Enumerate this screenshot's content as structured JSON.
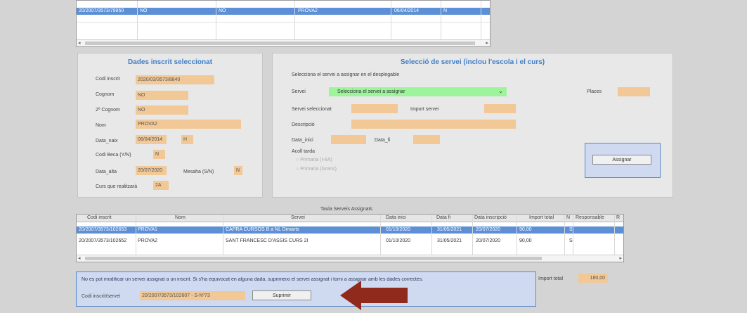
{
  "top_table": {
    "row": [
      "20/2007/3573/79950",
      "NO",
      "NO",
      "PROVA2",
      "06/04/2014",
      "N"
    ]
  },
  "panel_left": {
    "title": "Dades inscrit seleccionat",
    "fields": [
      {
        "label": "Codi inscrit",
        "value": "2020/03/3573/8840"
      },
      {
        "label": "Cognom",
        "value": "NO"
      },
      {
        "label": "2º Cognom",
        "value": "NO"
      },
      {
        "label": "Nom",
        "value": "PROVA2"
      },
      {
        "label": "Data_naix",
        "value": "06/04/2014",
        "extra": "H"
      },
      {
        "label": "Codi Beca (Y/N)",
        "value": "N"
      },
      {
        "label": "Data_alta",
        "value": "20/07/2020",
        "extra_label": "Mesaha (S/N)",
        "extra": "N"
      },
      {
        "label": "Curs que realitzarà",
        "value": "2A"
      }
    ]
  },
  "panel_right": {
    "title": "Selecció de servei (inclou l'escola i el curs)",
    "instruction": "Selecciona el servei a assignar en el desplegable",
    "servei_label": "Servei",
    "servei_select": "Selecciona el servei a assignar",
    "places_label": "Places",
    "servei_seleccionat_label": "Servei seleccionat",
    "import_servei_label": "Import servei",
    "descripcio_label": "Descripció",
    "data_inici_label": "Data_inici",
    "data_fi_label": "Data_fi",
    "acollida_label": "Acoll tarda",
    "radio1": "Primaria (I-6A)",
    "radio2": "Primaria (Grans)",
    "assign_button": "Assignar"
  },
  "assigned_table": {
    "caption": "Taula Serveis Assignats",
    "columns": [
      "Codi inscrit",
      "Nom",
      "Servei",
      "Data inici",
      "Data fi",
      "Data inscripció",
      "Import total",
      "N",
      "Responsable",
      "R"
    ],
    "rows": [
      [
        "20/2007/3573/102653",
        "PROVA1",
        "CAPRA CURSOS B a NL Dimarts",
        "01/10/2020",
        "31/05/2021",
        "20/07/2020",
        "90,00",
        "S",
        "",
        ""
      ],
      [
        "20/2007/3573/102652",
        "PROVA2",
        "SANT FRANCESC D'ASSIS CURS 2I",
        "01/10/2020",
        "31/05/2021",
        "20/07/2020",
        "90,00",
        "S",
        "",
        ""
      ]
    ]
  },
  "bottom_panel": {
    "message": "No es pot modificar un servei assignat a un inscrit. Si s'ha equivocat en alguna dada, suprimeixi el servei assignat i torni a assignar amb les dades correctes.",
    "codi_label": "Codi inscrit/servei",
    "codi_value": "20/2007/3573/102607 - S-Nº73",
    "delete_button": "Suprimir",
    "import_total_label": "Import total",
    "import_total_value": "180,00"
  },
  "colors": {
    "accent": "#3f7ec7",
    "selection": "#5c8fd6",
    "field": "#f1c896",
    "select": "#9cf59a",
    "arrow": "#8f2a1c"
  }
}
